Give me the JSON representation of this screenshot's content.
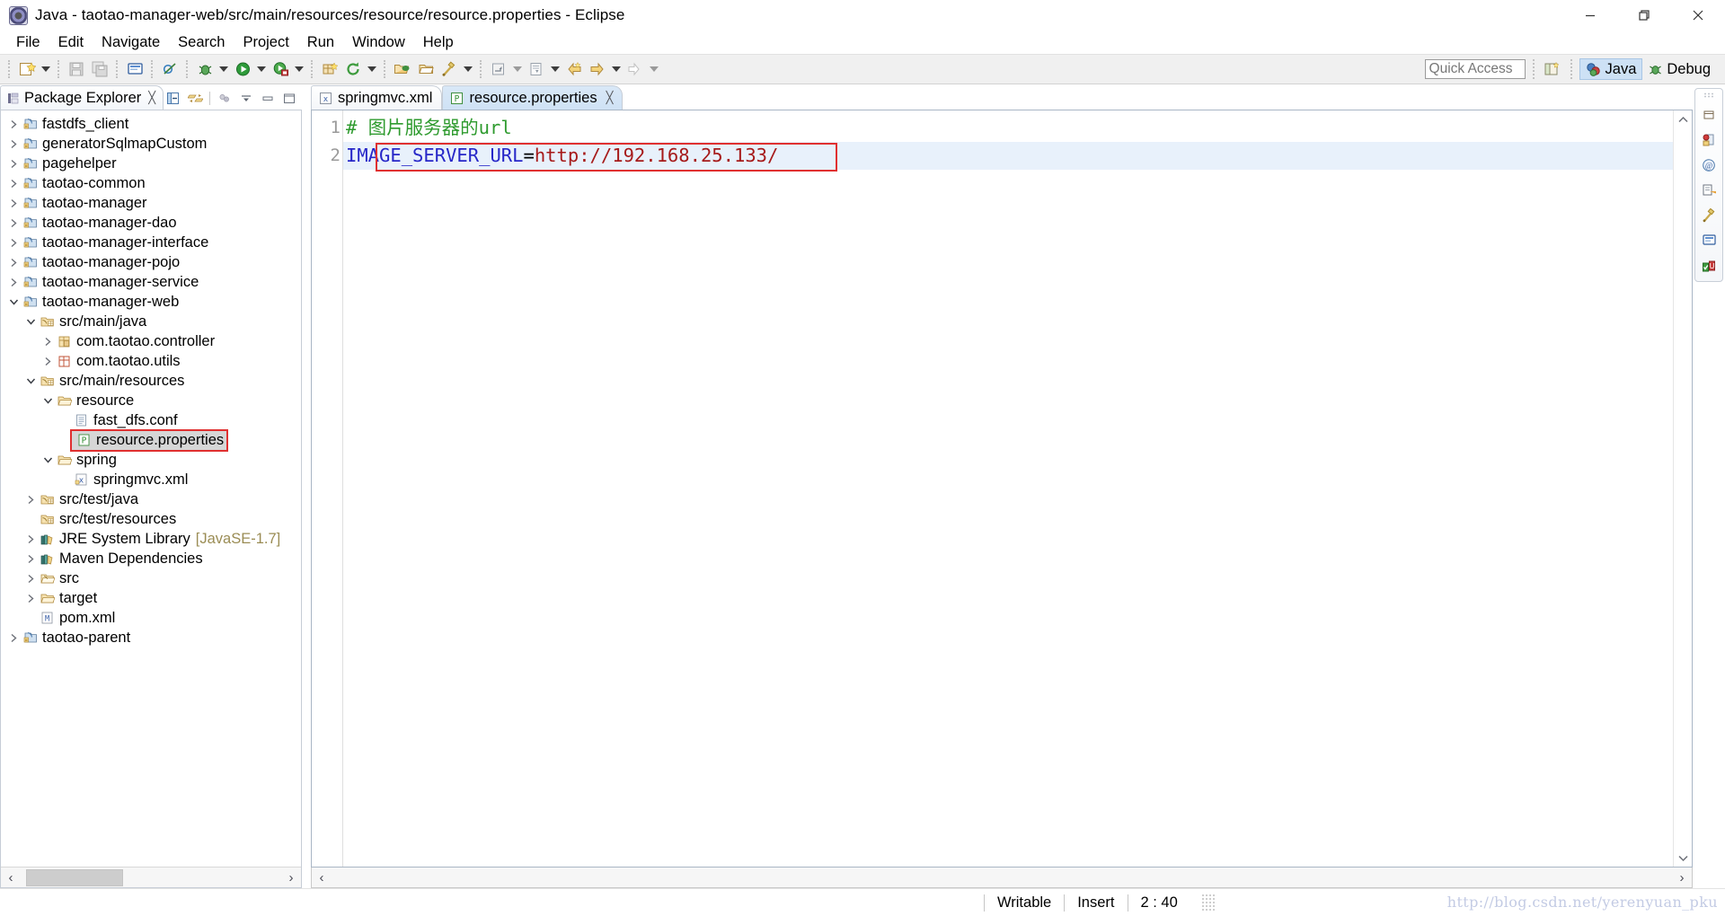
{
  "window": {
    "title": "Java - taotao-manager-web/src/main/resources/resource/resource.properties - Eclipse",
    "app_icon": "eclipse-icon",
    "minimize_label": "Minimize",
    "restore_label": "Restore",
    "close_label": "Close"
  },
  "menubar": {
    "items": [
      {
        "label": "File"
      },
      {
        "label": "Edit"
      },
      {
        "label": "Navigate"
      },
      {
        "label": "Search"
      },
      {
        "label": "Project"
      },
      {
        "label": "Run"
      },
      {
        "label": "Window"
      },
      {
        "label": "Help"
      }
    ]
  },
  "toolbar": {
    "icons": [
      {
        "name": "new-wizard-icon"
      },
      {
        "name": "save-icon"
      },
      {
        "name": "save-all-icon"
      },
      {
        "name": "console-icon"
      },
      {
        "name": "skip-breakpoints-icon"
      },
      {
        "name": "debug-icon"
      },
      {
        "name": "run-icon"
      },
      {
        "name": "coverage-icon"
      },
      {
        "name": "new-java-package-icon"
      },
      {
        "name": "refresh-icon"
      },
      {
        "name": "open-type-icon"
      },
      {
        "name": "open-task-icon"
      },
      {
        "name": "search-icon"
      },
      {
        "name": "last-edit-location-icon"
      },
      {
        "name": "next-annotation-icon"
      },
      {
        "name": "back-icon"
      },
      {
        "name": "forward-icon"
      }
    ],
    "quick_access": {
      "placeholder": "Quick Access",
      "value": ""
    },
    "open_perspective_label": "Open Perspective",
    "perspectives": [
      {
        "label": "Java",
        "active": true,
        "icon": "java-perspective-icon"
      },
      {
        "label": "Debug",
        "active": false,
        "icon": "debug-perspective-icon"
      }
    ]
  },
  "package_explorer": {
    "tab_label": "Package Explorer",
    "tab_icon": "package-explorer-icon",
    "close_icon": "close-icon",
    "tools": [
      {
        "name": "collapse-all-icon"
      },
      {
        "name": "link-with-editor-icon"
      },
      {
        "name": "view-menu-focus-icon"
      },
      {
        "name": "view-menu-icon"
      },
      {
        "name": "minimize-view-icon"
      },
      {
        "name": "maximize-view-icon"
      }
    ],
    "tree": [
      {
        "label": "fastdfs_client",
        "indent": 0,
        "twisty": "collapsed",
        "icon": "maven-project-icon"
      },
      {
        "label": "generatorSqlmapCustom",
        "indent": 0,
        "twisty": "collapsed",
        "icon": "java-project-icon"
      },
      {
        "label": "pagehelper",
        "indent": 0,
        "twisty": "collapsed",
        "icon": "maven-project-icon"
      },
      {
        "label": "taotao-common",
        "indent": 0,
        "twisty": "collapsed",
        "icon": "maven-project-icon"
      },
      {
        "label": "taotao-manager",
        "indent": 0,
        "twisty": "collapsed",
        "icon": "maven-project-icon"
      },
      {
        "label": "taotao-manager-dao",
        "indent": 0,
        "twisty": "collapsed",
        "icon": "maven-project-icon"
      },
      {
        "label": "taotao-manager-interface",
        "indent": 0,
        "twisty": "collapsed",
        "icon": "maven-project-icon"
      },
      {
        "label": "taotao-manager-pojo",
        "indent": 0,
        "twisty": "collapsed",
        "icon": "maven-project-icon"
      },
      {
        "label": "taotao-manager-service",
        "indent": 0,
        "twisty": "collapsed",
        "icon": "maven-project-icon"
      },
      {
        "label": "taotao-manager-web",
        "indent": 0,
        "twisty": "expanded",
        "icon": "maven-project-icon"
      },
      {
        "label": "src/main/java",
        "indent": 1,
        "twisty": "expanded",
        "icon": "source-folder-icon"
      },
      {
        "label": "com.taotao.controller",
        "indent": 2,
        "twisty": "collapsed",
        "icon": "package-icon"
      },
      {
        "label": "com.taotao.utils",
        "indent": 2,
        "twisty": "collapsed",
        "icon": "package-empty-icon"
      },
      {
        "label": "src/main/resources",
        "indent": 1,
        "twisty": "expanded",
        "icon": "source-folder-icon"
      },
      {
        "label": "resource",
        "indent": 2,
        "twisty": "expanded",
        "icon": "folder-icon"
      },
      {
        "label": "fast_dfs.conf",
        "indent": 3,
        "twisty": "none",
        "icon": "file-icon"
      },
      {
        "label": "resource.properties",
        "indent": 3,
        "twisty": "none",
        "icon": "properties-file-icon",
        "selected": true,
        "highlighted": true
      },
      {
        "label": "spring",
        "indent": 2,
        "twisty": "expanded",
        "icon": "folder-icon"
      },
      {
        "label": "springmvc.xml",
        "indent": 3,
        "twisty": "none",
        "icon": "xml-file-icon"
      },
      {
        "label": "src/test/java",
        "indent": 1,
        "twisty": "collapsed",
        "icon": "source-folder-icon"
      },
      {
        "label": "src/test/resources",
        "indent": 1,
        "twisty": "none",
        "icon": "source-folder-icon"
      },
      {
        "label": "JRE System Library",
        "suffix": "[JavaSE-1.7]",
        "indent": 1,
        "twisty": "collapsed",
        "icon": "library-icon"
      },
      {
        "label": "Maven Dependencies",
        "indent": 1,
        "twisty": "collapsed",
        "icon": "library-icon"
      },
      {
        "label": "src",
        "indent": 1,
        "twisty": "collapsed",
        "icon": "folder-plain-icon"
      },
      {
        "label": "target",
        "indent": 1,
        "twisty": "collapsed",
        "icon": "folder-icon"
      },
      {
        "label": "pom.xml",
        "indent": 1,
        "twisty": "none",
        "icon": "pom-file-icon"
      },
      {
        "label": "taotao-parent",
        "indent": 0,
        "twisty": "collapsed",
        "icon": "maven-project-icon"
      }
    ],
    "hscroll": {
      "left_arrow": "‹",
      "right_arrow": "›"
    }
  },
  "editor": {
    "tabs": [
      {
        "label": "springmvc.xml",
        "icon": "xml-file-icon",
        "active": false,
        "closeable": false
      },
      {
        "label": "resource.properties",
        "icon": "properties-file-icon",
        "active": true,
        "closeable": true,
        "close_icon": "close-icon"
      }
    ],
    "gutter_line_numbers": [
      "1",
      "2"
    ],
    "lines": [
      {
        "number": "1",
        "tokens": [
          {
            "text": "# 图片服务器的url",
            "type": "comment"
          }
        ],
        "current": false
      },
      {
        "number": "2",
        "tokens": [
          {
            "text": "IMAGE_SERVER_URL",
            "type": "key"
          },
          {
            "text": "=",
            "type": "operator"
          },
          {
            "text": "http://192.168.25.133/",
            "type": "value"
          }
        ],
        "current": true,
        "highlighted": true
      }
    ],
    "scroll_up_icon": "chevron-up-icon",
    "scroll_down_icon": "chevron-down-icon",
    "hscroll": {
      "left_arrow": "‹",
      "right_arrow": "›"
    }
  },
  "fast_view_bar": {
    "icons": [
      {
        "name": "restore-view-icon"
      },
      {
        "name": "problems-view-icon"
      },
      {
        "name": "javadoc-view-icon"
      },
      {
        "name": "declaration-view-icon"
      },
      {
        "name": "search-view-icon"
      },
      {
        "name": "console-view-icon"
      },
      {
        "name": "junit-view-icon"
      }
    ]
  },
  "statusbar": {
    "writable": "Writable",
    "insert_mode": "Insert",
    "cursor_position": "2 : 40",
    "watermark": "http://blog.csdn.net/yerenyuan_pku"
  },
  "colors": {
    "comment_green": "#2f9b2f",
    "key_blue": "#2727c8",
    "value_red": "#a61a1a",
    "highlight_red": "#e03030",
    "active_tab_blue": "#cfe2f5",
    "selection_grey": "#d6d6d6",
    "suffix_tan": "#9a8c54",
    "watermark_blue": "#c3cbe4"
  }
}
